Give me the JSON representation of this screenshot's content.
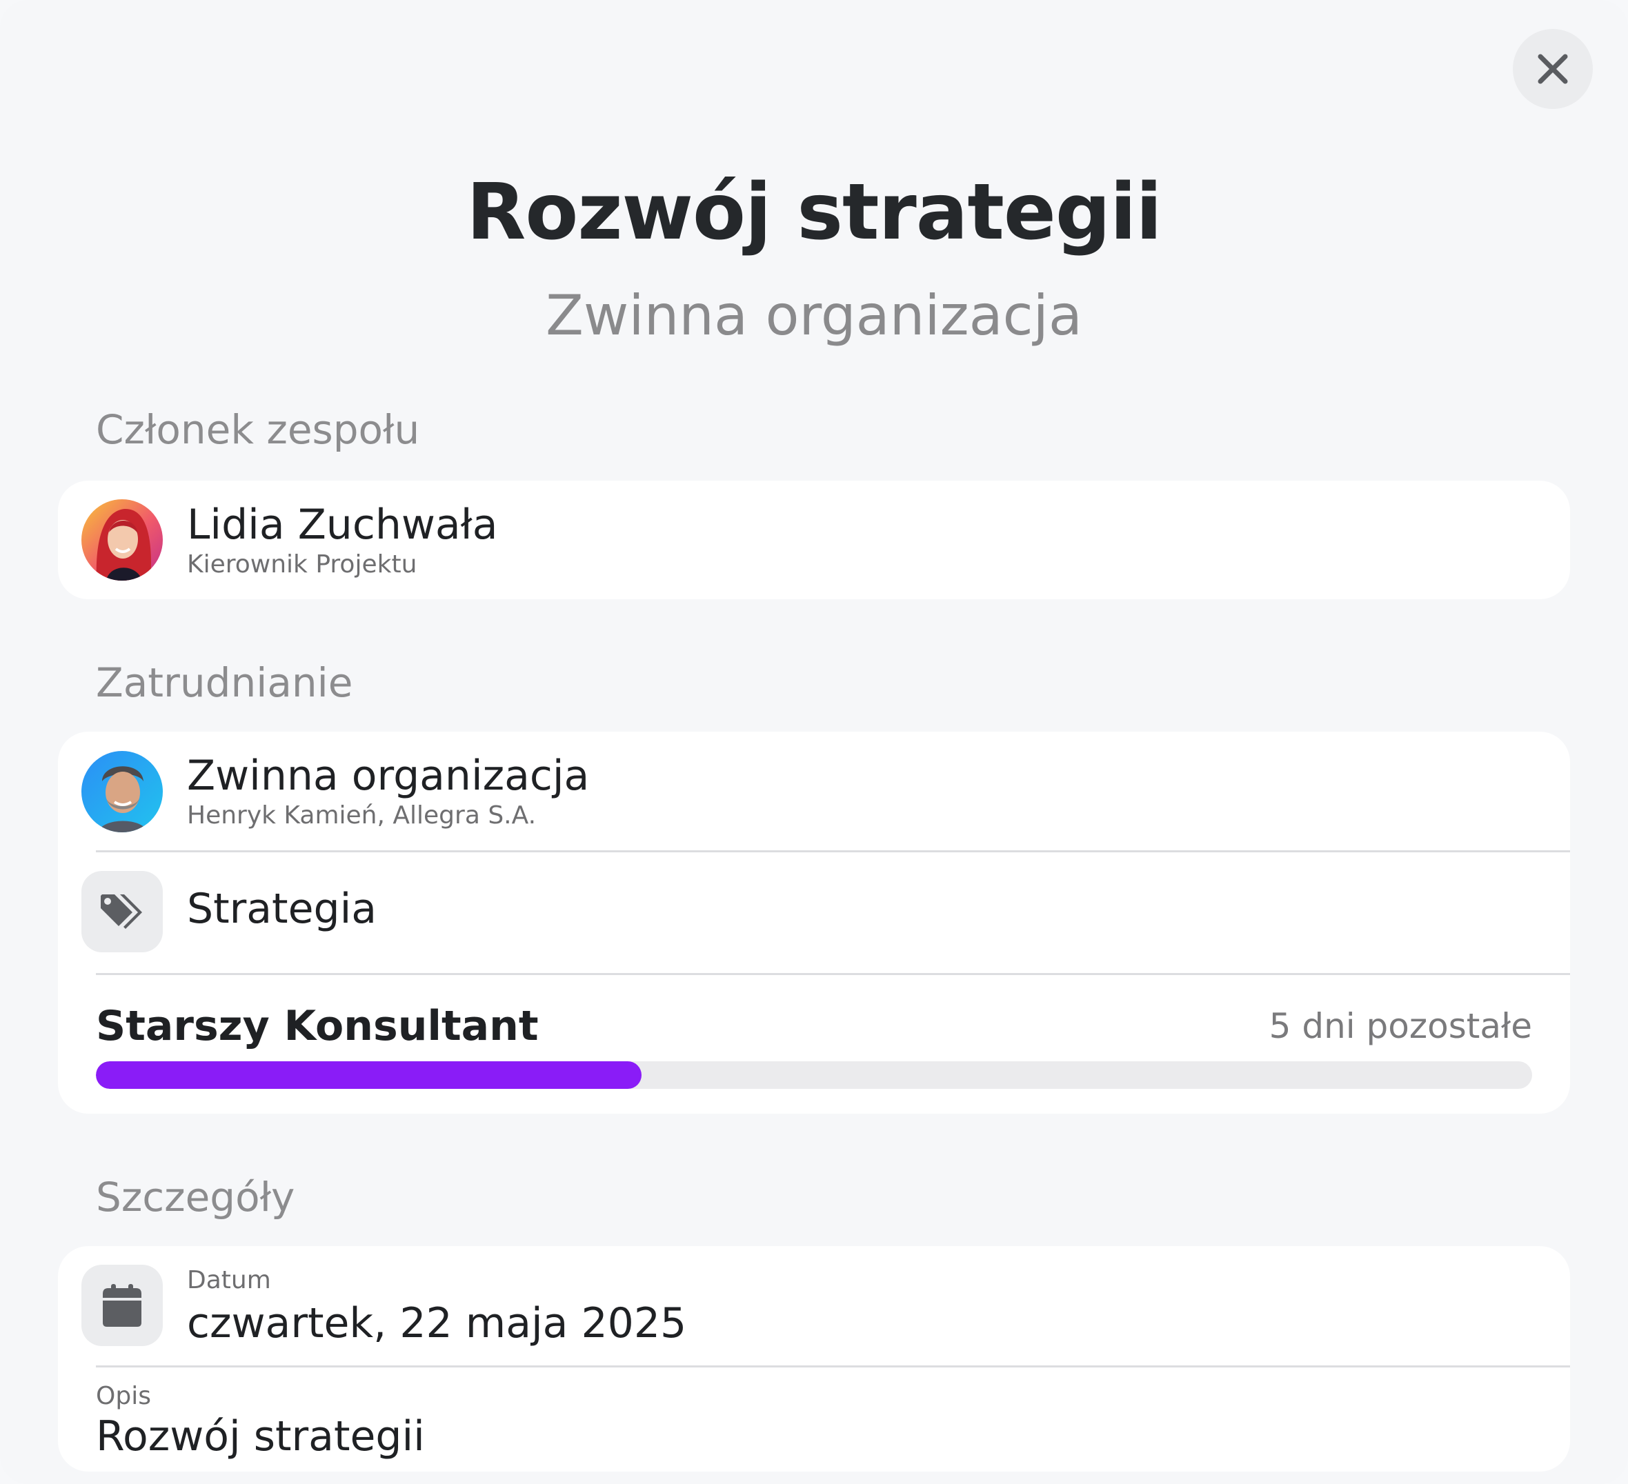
{
  "header": {
    "title": "Rozwój strategii",
    "subtitle": "Zwinna organizacja"
  },
  "colors": {
    "accent": "#8a1cf7",
    "background": "#f6f7f9",
    "card": "#ffffff"
  },
  "team_member": {
    "section_label": "Członek zespołu",
    "name": "Lidia Zuchwała",
    "role": "Kierownik Projektu"
  },
  "employment": {
    "section_label": "Zatrudnianie",
    "company": "Zwinna organizacja",
    "company_detail": "Henryk Kamień, Allegra S.A.",
    "category": "Strategia",
    "category_icon": "tag-icon",
    "position": "Starszy Konsultant",
    "remaining": "5 dni pozostałe",
    "progress_fraction": 0.38
  },
  "details": {
    "section_label": "Szczegóły",
    "date_label": "Datum",
    "date_value": "czwartek, 22 maja 2025",
    "date_icon": "calendar-icon",
    "description_label": "Opis",
    "description_value": "Rozwój strategii"
  },
  "icons": {
    "close": "close-icon"
  }
}
